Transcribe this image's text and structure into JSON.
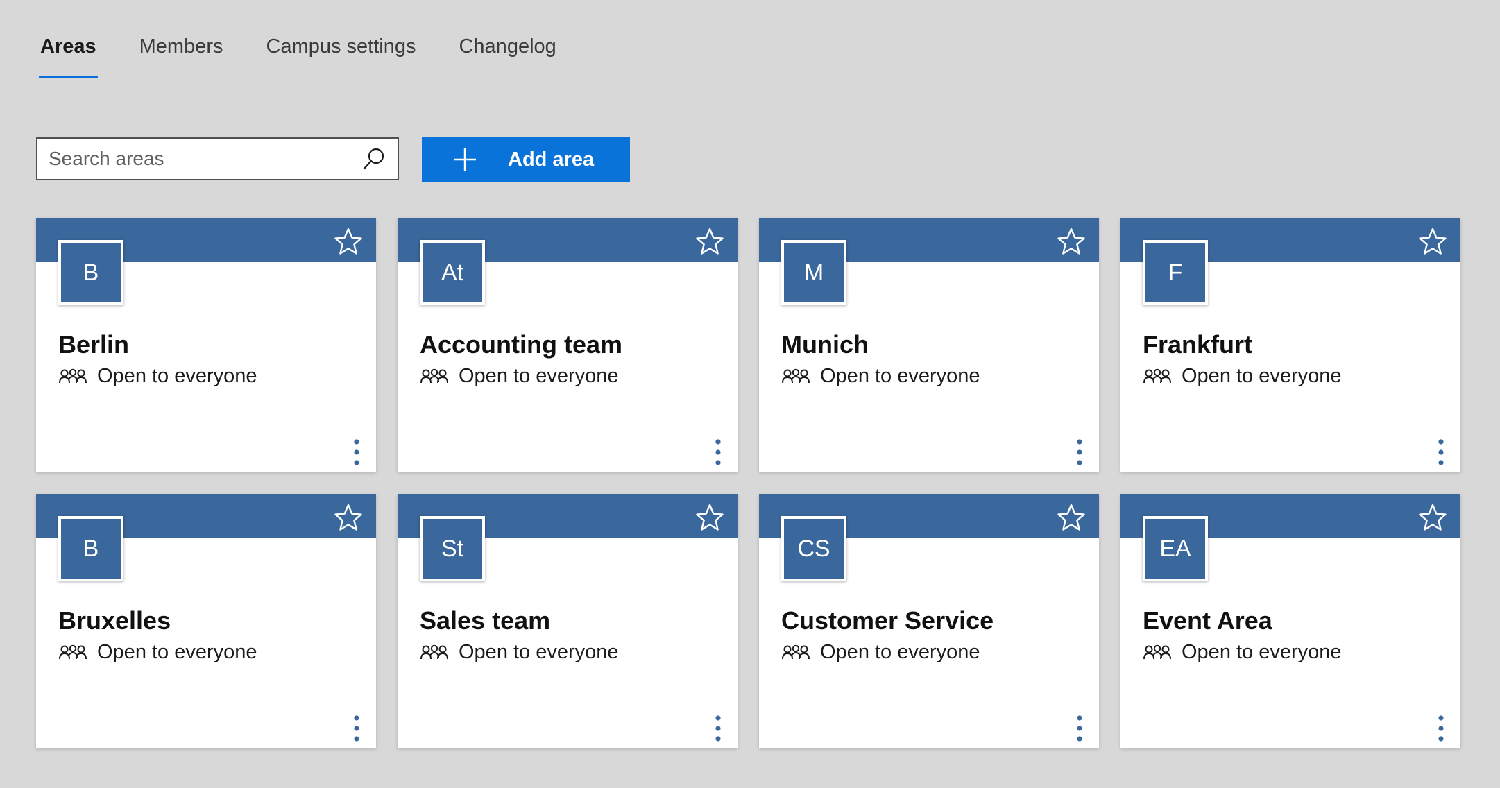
{
  "tabs": [
    {
      "label": "Areas",
      "active": true
    },
    {
      "label": "Members",
      "active": false
    },
    {
      "label": "Campus settings",
      "active": false
    },
    {
      "label": "Changelog",
      "active": false
    }
  ],
  "toolbar": {
    "search_placeholder": "Search areas",
    "search_value": "",
    "add_label": "Add area",
    "add_icon": "plus-icon",
    "search_icon": "search-icon"
  },
  "colors": {
    "accent": "#0a73d9",
    "card_header": "#3a679c",
    "background": "#d8d8d8"
  },
  "areas": [
    {
      "initials": "B",
      "name": "Berlin",
      "access": "Open to everyone"
    },
    {
      "initials": "At",
      "name": "Accounting team",
      "access": "Open to everyone"
    },
    {
      "initials": "M",
      "name": "Munich",
      "access": "Open to everyone"
    },
    {
      "initials": "F",
      "name": "Frankfurt",
      "access": "Open to everyone"
    },
    {
      "initials": "B",
      "name": "Bruxelles",
      "access": "Open to everyone"
    },
    {
      "initials": "St",
      "name": "Sales team",
      "access": "Open to everyone"
    },
    {
      "initials": "CS",
      "name": "Customer Service",
      "access": "Open to everyone"
    },
    {
      "initials": "EA",
      "name": "Event Area",
      "access": "Open to everyone"
    }
  ]
}
